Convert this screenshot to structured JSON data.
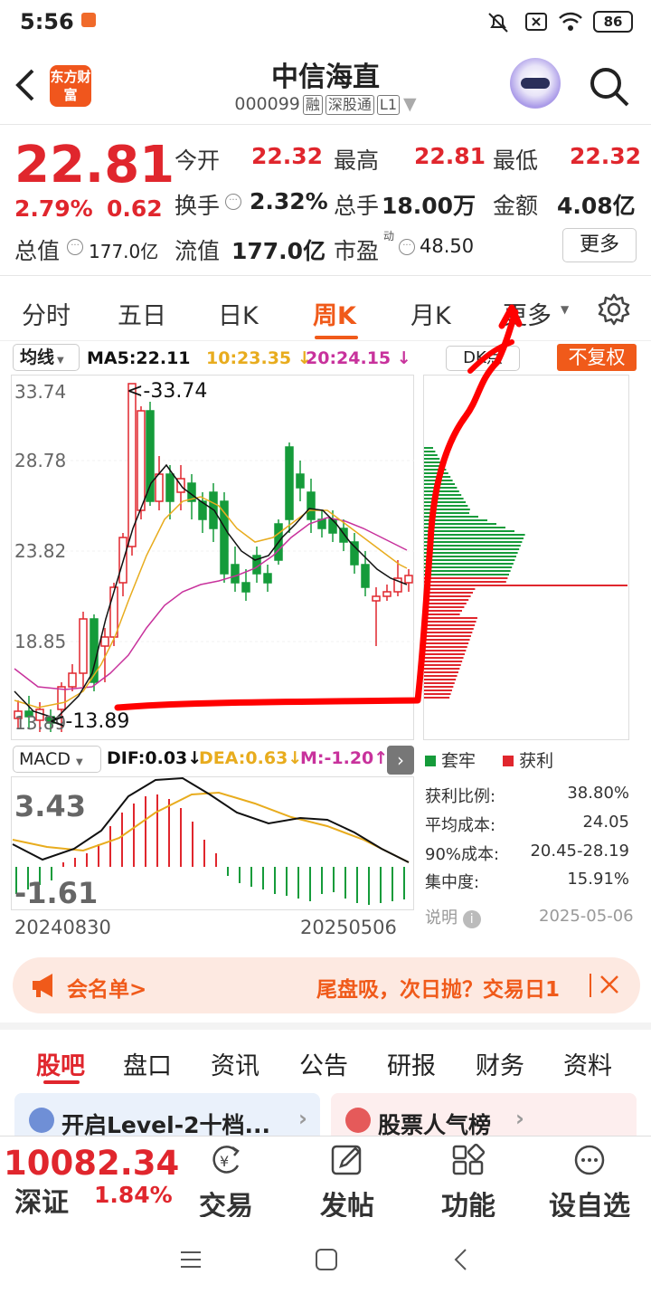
{
  "status": {
    "time": "5:56",
    "battery": "86"
  },
  "header": {
    "logo": "东方财富",
    "name": "中信海直",
    "code": "000099",
    "tags": [
      "融",
      "深股通",
      "L1"
    ]
  },
  "quote": {
    "price": "22.81",
    "pct": "2.79%",
    "chg": "0.62",
    "open_lbl": "今开",
    "open": "22.32",
    "high_lbl": "最高",
    "high": "22.81",
    "low_lbl": "最低",
    "low": "22.32",
    "turn_lbl": "换手",
    "turn": "2.32%",
    "vol_lbl": "总手",
    "vol": "18.00万",
    "amt_lbl": "金额",
    "amt": "4.08亿",
    "mcap_lbl": "总值",
    "mcap": "177.0亿",
    "fcap_lbl": "流值",
    "fcap": "177.0亿",
    "pe_lbl": "市盈",
    "pe_sup": "动",
    "pe": "48.50",
    "more": "更多"
  },
  "tabs": [
    "分时",
    "五日",
    "日K",
    "周K",
    "月K",
    "更多"
  ],
  "kline": {
    "ma_btn": "均线",
    "ma5": "MA5:22.11",
    "ma10": "10:23.35",
    "ma20": "20:24.15",
    "dk": "DK点",
    "adj": "不复权",
    "yticks": [
      "33.74",
      "28.78",
      "23.82",
      "18.85",
      "13.89"
    ],
    "max_label": "<-33.74",
    "min_label": "<-13.89"
  },
  "macd": {
    "btn": "MACD",
    "dif": "DIF:0.03",
    "dea": "DEA:0.63",
    "m": "M:-1.20",
    "top": "3.43",
    "bottom": "-1.61",
    "d1": "20240830",
    "d2": "20250506"
  },
  "chip": {
    "legend_a": "套牢",
    "legend_b": "获利",
    "rows": [
      {
        "k": "获利比例:",
        "v": "38.80%"
      },
      {
        "k": "平均成本:",
        "v": "24.05"
      },
      {
        "k": "90%成本:",
        "v": "20.45-28.19"
      },
      {
        "k": "集中度:",
        "v": "15.91%"
      }
    ],
    "note": "说明",
    "date": "2025-05-06"
  },
  "banner": {
    "left": "会名单>",
    "right": "尾盘吸，次日抛？交易日1"
  },
  "subtabs": [
    "股吧",
    "盘口",
    "资讯",
    "公告",
    "研报",
    "财务",
    "资料"
  ],
  "cards": {
    "a": "开启Level-2十档...",
    "b": "股票人气榜"
  },
  "bottom": {
    "index": "10082.34",
    "index_name": "深证",
    "index_pct": "1.84%",
    "items": [
      "交易",
      "发帖",
      "功能",
      "设自选"
    ]
  },
  "colors": {
    "up": "#e0262d",
    "down": "#159b3a",
    "accent": "#f05a1a"
  }
}
